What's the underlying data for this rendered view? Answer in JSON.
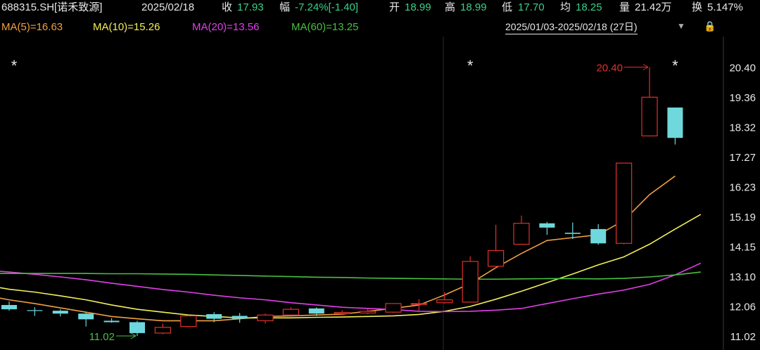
{
  "header": {
    "symbol": "688315.SH[诺禾致源]",
    "date": "2025/02/18",
    "close_label": "收",
    "close": "17.93",
    "change_label": "幅",
    "change": "-7.24%[-1.40]",
    "open_label": "开",
    "open": "18.99",
    "high_label": "高",
    "high": "18.99",
    "low_label": "低",
    "low": "17.70",
    "avg_label": "均",
    "avg": "18.25",
    "volume_label": "量",
    "volume": "21.42万",
    "turnover_label": "换",
    "turnover": "5.147%"
  },
  "ma_bar": {
    "ma5": "MA(5)=16.63",
    "ma10": "MA(10)=15.26",
    "ma20": "MA(20)=13.56",
    "ma60": "MA(60)=13.25",
    "range": "2025/01/03-2025/02/18 (27日)"
  },
  "colors": {
    "background": "#000000",
    "up": "#e0302a",
    "down": "#6fd8dc",
    "ma5": "#f0a040",
    "ma10": "#f2ee5a",
    "ma20": "#e040e8",
    "ma60": "#48c040",
    "grid": "#2a2a2a",
    "axis_text": "#e8e8e8",
    "header_value": "#3ad08a"
  },
  "icons": {
    "range_caret": "▼",
    "lock": "🔒"
  },
  "chart_data": {
    "type": "candlestick",
    "y_ticks": [
      11.02,
      12.06,
      13.1,
      14.15,
      15.19,
      16.23,
      17.27,
      18.32,
      19.36,
      20.4
    ],
    "ylim": [
      10.65,
      21.3
    ],
    "annotations": {
      "max": {
        "label": "20.40",
        "value": 20.4,
        "index": 25
      },
      "min": {
        "label": "11.02",
        "value": 11.02,
        "index": 5
      },
      "markers": [
        {
          "label": "*",
          "index": 0
        },
        {
          "label": "*",
          "index": 18
        },
        {
          "label": "*",
          "index": 26
        }
      ]
    },
    "candles": [
      {
        "o": 12.1,
        "h": 12.22,
        "l": 11.9,
        "c": 11.95
      },
      {
        "o": 11.92,
        "h": 12.02,
        "l": 11.72,
        "c": 11.9
      },
      {
        "o": 11.9,
        "h": 11.95,
        "l": 11.7,
        "c": 11.8
      },
      {
        "o": 11.8,
        "h": 11.85,
        "l": 11.35,
        "c": 11.6
      },
      {
        "o": 11.55,
        "h": 11.64,
        "l": 11.48,
        "c": 11.5
      },
      {
        "o": 11.5,
        "h": 11.55,
        "l": 11.02,
        "c": 11.12
      },
      {
        "o": 11.12,
        "h": 11.45,
        "l": 11.08,
        "c": 11.32
      },
      {
        "o": 11.35,
        "h": 11.75,
        "l": 11.33,
        "c": 11.72
      },
      {
        "o": 11.78,
        "h": 11.85,
        "l": 11.5,
        "c": 11.62
      },
      {
        "o": 11.72,
        "h": 11.82,
        "l": 11.48,
        "c": 11.62
      },
      {
        "o": 11.55,
        "h": 11.8,
        "l": 11.45,
        "c": 11.75
      },
      {
        "o": 11.75,
        "h": 12.02,
        "l": 11.74,
        "c": 11.95
      },
      {
        "o": 11.98,
        "h": 12.02,
        "l": 11.72,
        "c": 11.8
      },
      {
        "o": 11.8,
        "h": 11.92,
        "l": 11.74,
        "c": 11.84
      },
      {
        "o": 11.82,
        "h": 11.98,
        "l": 11.78,
        "c": 11.88
      },
      {
        "o": 11.85,
        "h": 12.15,
        "l": 11.82,
        "c": 12.15
      },
      {
        "o": 12.15,
        "h": 12.3,
        "l": 11.85,
        "c": 12.15
      },
      {
        "o": 12.18,
        "h": 12.55,
        "l": 12.15,
        "c": 12.28
      },
      {
        "o": 12.2,
        "h": 13.8,
        "l": 12.18,
        "c": 13.62
      },
      {
        "o": 13.45,
        "h": 14.9,
        "l": 13.38,
        "c": 14.0
      },
      {
        "o": 14.22,
        "h": 15.22,
        "l": 14.2,
        "c": 14.95
      },
      {
        "o": 14.95,
        "h": 15.0,
        "l": 14.55,
        "c": 14.8
      },
      {
        "o": 14.62,
        "h": 14.98,
        "l": 14.4,
        "c": 14.58
      },
      {
        "o": 14.75,
        "h": 14.92,
        "l": 14.2,
        "c": 14.25
      },
      {
        "o": 14.25,
        "h": 17.05,
        "l": 14.22,
        "c": 17.05
      },
      {
        "o": 18.0,
        "h": 20.4,
        "l": 17.98,
        "c": 19.35
      },
      {
        "o": 18.99,
        "h": 18.99,
        "l": 17.7,
        "c": 17.93
      }
    ],
    "series": [
      {
        "name": "MA(5)",
        "values": [
          12.45,
          12.28,
          12.15,
          12.0,
          11.85,
          11.7,
          11.62,
          11.55,
          11.55,
          11.55,
          11.62,
          11.7,
          11.72,
          11.75,
          11.78,
          11.88,
          11.98,
          12.1,
          12.45,
          12.85,
          13.4,
          13.9,
          14.35,
          14.45,
          14.55,
          15.05,
          15.95,
          16.6
        ]
      },
      {
        "name": "MA(10)",
        "values": [
          12.8,
          12.65,
          12.55,
          12.42,
          12.28,
          12.1,
          11.95,
          11.85,
          11.75,
          11.7,
          11.65,
          11.65,
          11.65,
          11.67,
          11.68,
          11.7,
          11.72,
          11.77,
          11.88,
          12.05,
          12.3,
          12.58,
          12.88,
          13.18,
          13.5,
          13.78,
          14.22,
          14.75,
          15.26
        ]
      },
      {
        "name": "MA(20)",
        "values": [
          13.32,
          13.25,
          13.17,
          13.08,
          12.98,
          12.86,
          12.75,
          12.64,
          12.55,
          12.44,
          12.35,
          12.28,
          12.18,
          12.1,
          12.02,
          11.98,
          11.94,
          11.88,
          11.87,
          11.88,
          11.92,
          11.98,
          12.15,
          12.32,
          12.48,
          12.62,
          12.82,
          13.15,
          13.56
        ]
      },
      {
        "name": "MA(60)",
        "values": [
          13.2,
          13.2,
          13.2,
          13.2,
          13.2,
          13.19,
          13.19,
          13.18,
          13.17,
          13.15,
          13.13,
          13.11,
          13.09,
          13.07,
          13.06,
          13.04,
          13.03,
          13.02,
          13.01,
          13.0,
          13.0,
          13.01,
          13.02,
          13.02,
          13.01,
          13.03,
          13.08,
          13.15,
          13.25
        ]
      }
    ]
  }
}
